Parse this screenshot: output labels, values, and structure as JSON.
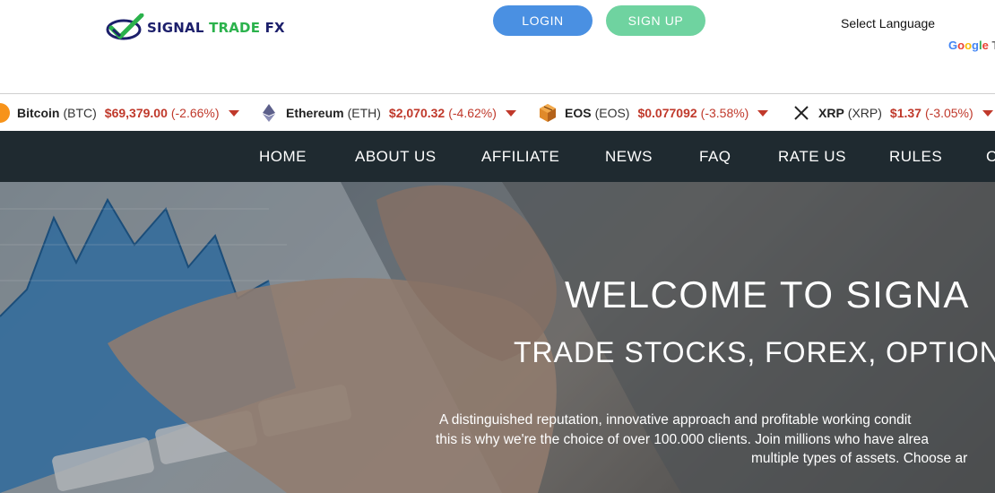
{
  "header": {
    "logo": {
      "word1": "SIGNAL",
      "word2": "TRADE",
      "word3": "FX"
    },
    "login_label": "LOGIN",
    "signup_label": "SIGN UP",
    "language_label": "Select Language",
    "google_label": "Google",
    "translate_partial": "Tr"
  },
  "ticker": [
    {
      "name": "Bitcoin",
      "symbol": "(BTC)",
      "price": "$69,379.00",
      "change": "(-2.66%)",
      "icon": "bitcoin-icon"
    },
    {
      "name": "Ethereum",
      "symbol": "(ETH)",
      "price": "$2,070.32",
      "change": "(-4.62%)",
      "icon": "ethereum-icon"
    },
    {
      "name": "EOS",
      "symbol": "(EOS)",
      "price": "$0.077092",
      "change": "(-3.58%)",
      "icon": "eos-icon"
    },
    {
      "name": "XRP",
      "symbol": "(XRP)",
      "price": "$1.37",
      "change": "(-3.05%)",
      "icon": "xrp-icon"
    }
  ],
  "nav": {
    "items": [
      "HOME",
      "ABOUT US",
      "AFFILIATE",
      "NEWS",
      "FAQ",
      "RATE US",
      "RULES",
      "C"
    ]
  },
  "hero": {
    "title": "WELCOME TO SIGNA",
    "subtitle": "TRADE STOCKS, FOREX, OPTION",
    "line1": "A distinguished reputation, innovative approach and profitable working condit",
    "line2": "this is why we're the choice of over 100.000 clients. Join millions who have alrea",
    "line3": "multiple types of assets. Choose ar"
  },
  "colors": {
    "nav_bg": "#1f2a30",
    "login_bg": "#4a90e2",
    "signup_bg": "#6fd3a0",
    "price_down": "#c0392b"
  }
}
